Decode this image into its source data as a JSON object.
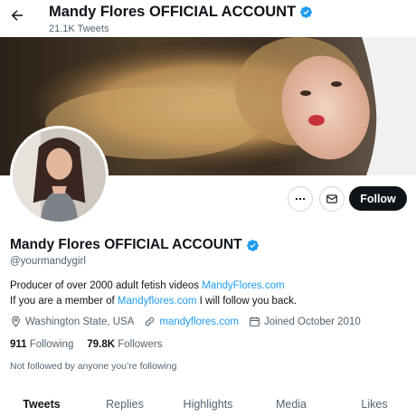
{
  "header": {
    "title": "Mandy Flores OFFICIAL ACCOUNT",
    "tweet_count": "21.1K Tweets"
  },
  "profile": {
    "display_name": "Mandy Flores OFFICIAL ACCOUNT",
    "handle": "@yourmandygirl",
    "bio_line1_text": "Producer of over 2000 adult fetish videos",
    "bio_line1_link": "MandyFlores.com",
    "bio_line2_prefix": "If you are a member of",
    "bio_line2_link": "Mandyflores.com",
    "bio_line2_suffix": "I will follow you back.",
    "location": "Washington State, USA",
    "website": "mandyflores.com",
    "joined": "Joined October 2010",
    "following_count": "911",
    "following_label": "Following",
    "followers_count": "79.8K",
    "followers_label": "Followers",
    "not_followed_note": "Not followed by anyone you’re following"
  },
  "actions": {
    "follow_label": "Follow",
    "more_icon": "more-horizontal-icon",
    "message_icon": "envelope-icon"
  },
  "tabs": [
    {
      "label": "Tweets",
      "active": true
    },
    {
      "label": "Replies",
      "active": false
    },
    {
      "label": "Highlights",
      "active": false
    },
    {
      "label": "Media",
      "active": false
    },
    {
      "label": "Likes",
      "active": false
    }
  ],
  "colors": {
    "accent": "#1d9bf0",
    "text_primary": "#0f1419",
    "text_secondary": "#536471",
    "follow_button_bg": "#0f1419"
  }
}
